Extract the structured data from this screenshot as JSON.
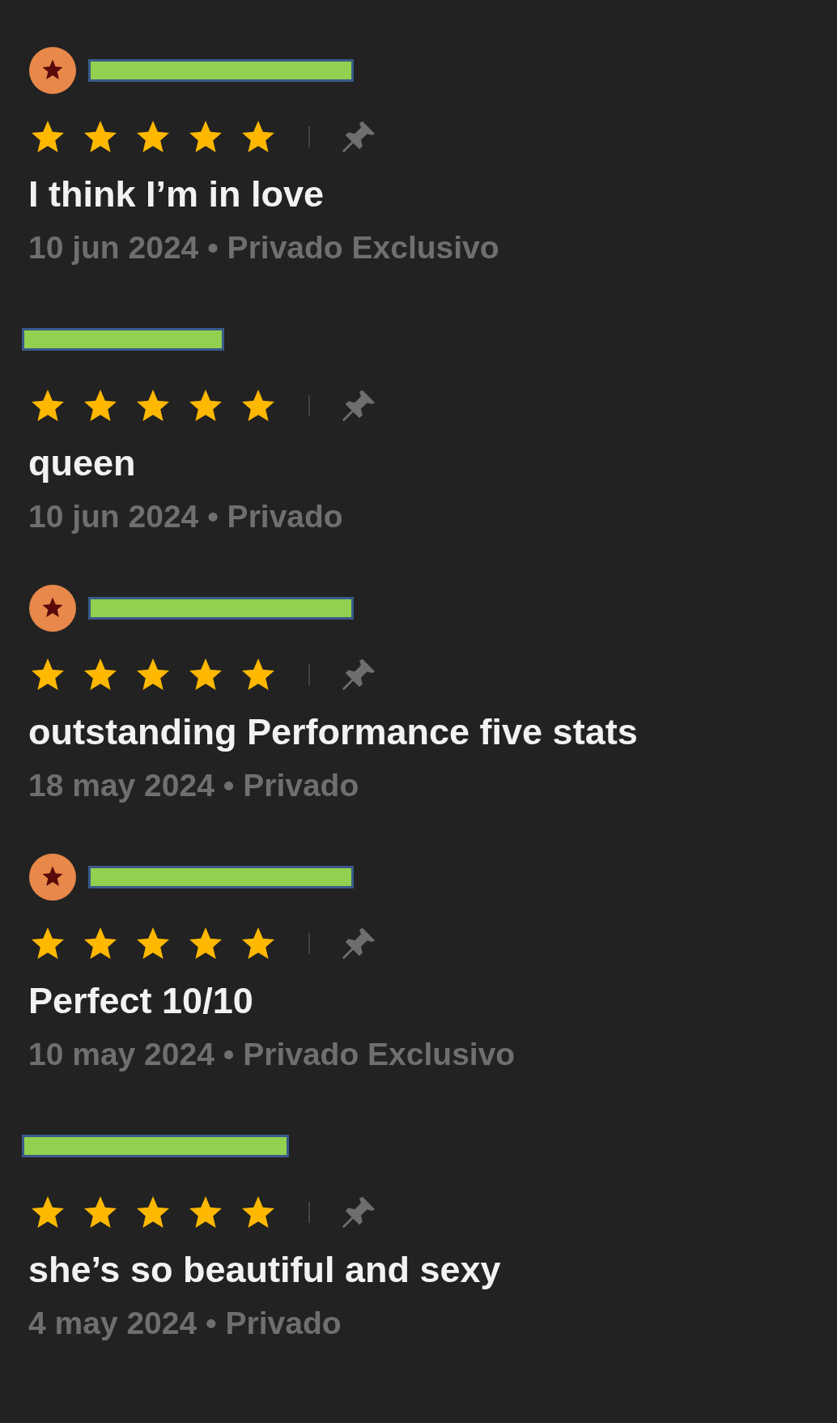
{
  "reviews": [
    {
      "badge": true,
      "stars": 5,
      "text": "I think I’m in love",
      "meta": "10 jun 2024 • Privado Exclusivo"
    },
    {
      "badge": false,
      "stars": 5,
      "text": "queen",
      "meta": "10 jun 2024 • Privado"
    },
    {
      "badge": true,
      "stars": 5,
      "text": "outstanding Performance five stats",
      "meta": "18 may 2024 • Privado"
    },
    {
      "badge": true,
      "stars": 5,
      "text": "Perfect 10/10",
      "meta": "10 may 2024 • Privado Exclusivo"
    },
    {
      "badge": false,
      "stars": 5,
      "text": "she’s so beautiful and sexy",
      "meta": "4 may 2024 • Privado"
    }
  ]
}
